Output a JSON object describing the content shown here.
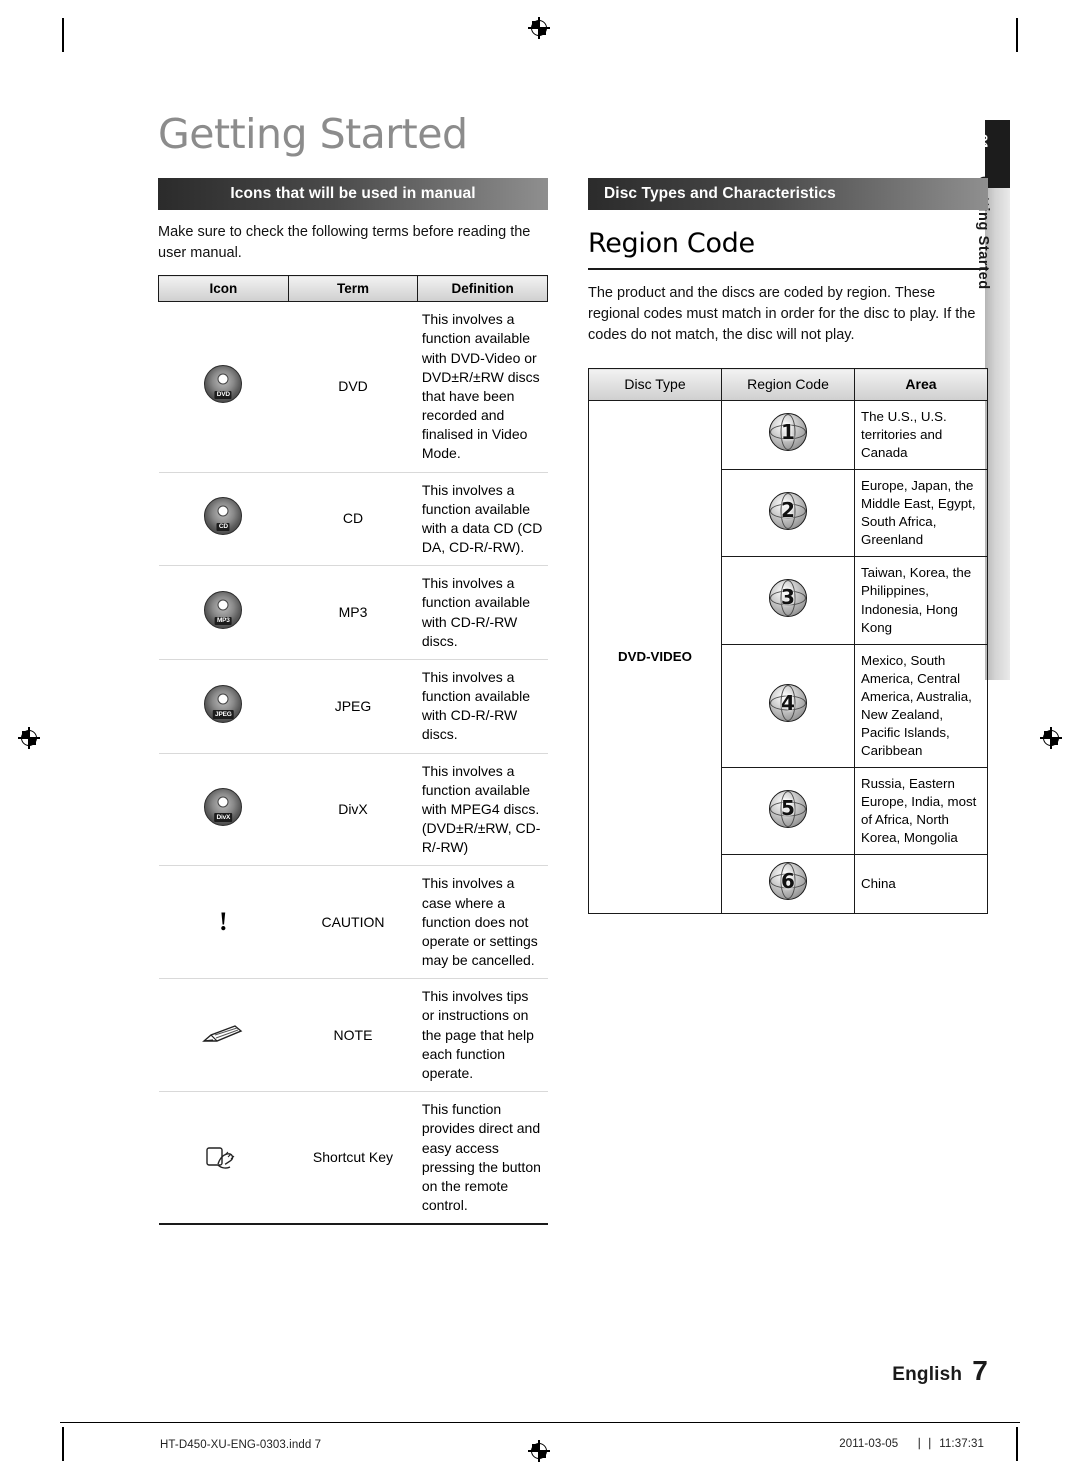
{
  "page": {
    "title": "Getting Started",
    "side_tab": {
      "number": "01",
      "label": "Getting Started"
    },
    "footer": {
      "language": "English",
      "page_number": "7",
      "file_name": "HT-D450-XU-ENG-0303.indd   7",
      "date": "2011-03-05",
      "time": "11:37:31",
      "separator": "⎹⎹"
    }
  },
  "left": {
    "heading": "Icons that will be used in manual",
    "intro": "Make sure to check the following terms before reading the user manual.",
    "table": {
      "headers": [
        "Icon",
        "Term",
        "Definition"
      ],
      "rows": [
        {
          "icon": "dvd-disc-icon",
          "icon_label": "DVD",
          "term": "DVD",
          "definition": "This involves a function available with DVD-Video or DVD±R/±RW discs that have been recorded and finalised in Video Mode."
        },
        {
          "icon": "cd-disc-icon",
          "icon_label": "CD",
          "term": "CD",
          "definition": "This involves a function available with a data CD (CD DA, CD-R/-RW)."
        },
        {
          "icon": "mp3-disc-icon",
          "icon_label": "MP3",
          "term": "MP3",
          "definition": "This involves a function available with CD-R/-RW discs."
        },
        {
          "icon": "jpeg-disc-icon",
          "icon_label": "JPEG",
          "term": "JPEG",
          "definition": "This involves a function available with CD-R/-RW discs."
        },
        {
          "icon": "divx-disc-icon",
          "icon_label": "DivX",
          "term": "DivX",
          "definition": "This involves a function available with MPEG4 discs. (DVD±R/±RW, CD-R/-RW)"
        },
        {
          "icon": "caution-icon",
          "icon_label": "!",
          "term": "CAUTION",
          "definition": "This involves a case where a function does not operate or settings may be cancelled."
        },
        {
          "icon": "note-pencil-icon",
          "icon_label": "",
          "term": "NOTE",
          "definition": "This involves tips or instructions on the page that help each function operate."
        },
        {
          "icon": "shortcut-hand-icon",
          "icon_label": "",
          "term": "Shortcut Key",
          "definition": "This function provides direct and easy access pressing the button on the remote control."
        }
      ]
    }
  },
  "right": {
    "heading": "Disc Types and Characteristics",
    "region_title": "Region Code",
    "region_body": "The product and the discs are coded by region. These regional codes must match in order for the disc to play. If the codes do not match, the disc will not play.",
    "table": {
      "headers": [
        "Disc Type",
        "Region Code",
        "Area"
      ],
      "disc_type": "DVD-VIDEO",
      "rows": [
        {
          "code": "1",
          "area": "The U.S., U.S. territories and Canada"
        },
        {
          "code": "2",
          "area": "Europe, Japan, the Middle East, Egypt, South Africa, Greenland"
        },
        {
          "code": "3",
          "area": "Taiwan, Korea, the Philippines, Indonesia, Hong Kong"
        },
        {
          "code": "4",
          "area": "Mexico, South America, Central America, Australia, New Zealand, Pacific Islands, Caribbean"
        },
        {
          "code": "5",
          "area": "Russia, Eastern Europe, India, most of Africa, North Korea, Mongolia"
        },
        {
          "code": "6",
          "area": "China"
        }
      ]
    }
  },
  "colors": {
    "heading_dark": "#2b2b2b",
    "heading_light": "#8f8f8f",
    "title_gray": "#8c8c8c",
    "rule_black": "#1a1a1a"
  }
}
